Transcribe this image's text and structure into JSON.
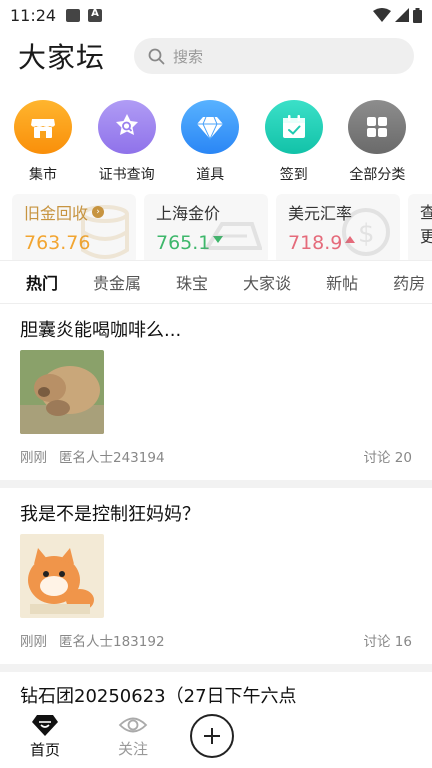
{
  "status_bar": {
    "time": "11:24"
  },
  "header": {
    "logo": "大家坛",
    "search_placeholder": "搜索"
  },
  "categories": [
    {
      "label": "集市",
      "icon": "shop-icon",
      "color": "#f98f0a"
    },
    {
      "label": "证书查询",
      "icon": "certificate-icon",
      "color": "#8f72ea"
    },
    {
      "label": "道具",
      "icon": "diamond-icon",
      "color": "#2a86f5"
    },
    {
      "label": "签到",
      "icon": "calendar-check-icon",
      "color": "#12c2a8"
    },
    {
      "label": "全部分类",
      "icon": "grid-icon",
      "color": "#6a6a6a"
    }
  ],
  "prices": [
    {
      "title": "旧金回收",
      "value": "763.76",
      "trend": "",
      "color": "#f2a531"
    },
    {
      "title": "上海金价",
      "value": "765.1",
      "trend": "down",
      "color": "#3eb76b"
    },
    {
      "title": "美元汇率",
      "value": "718.9",
      "trend": "up",
      "color": "#e56b7b"
    },
    {
      "title": "查",
      "value": "更"
    }
  ],
  "tabs": [
    "热门",
    "贵金属",
    "珠宝",
    "大家谈",
    "新帖",
    "药房"
  ],
  "active_tab": "热门",
  "posts": [
    {
      "title": "胆囊炎能喝咖啡么...",
      "time": "刚刚",
      "author": "匿名人士243194",
      "discussion": "讨论 20"
    },
    {
      "title": "我是不是控制狂妈妈？",
      "time": "刚刚",
      "author": "匿名人士183192",
      "discussion": "讨论 16"
    }
  ],
  "partial_post": {
    "title": "钻石团20250623（27日下午六点"
  },
  "bottom_nav": {
    "home": "首页",
    "follow": "关注"
  }
}
